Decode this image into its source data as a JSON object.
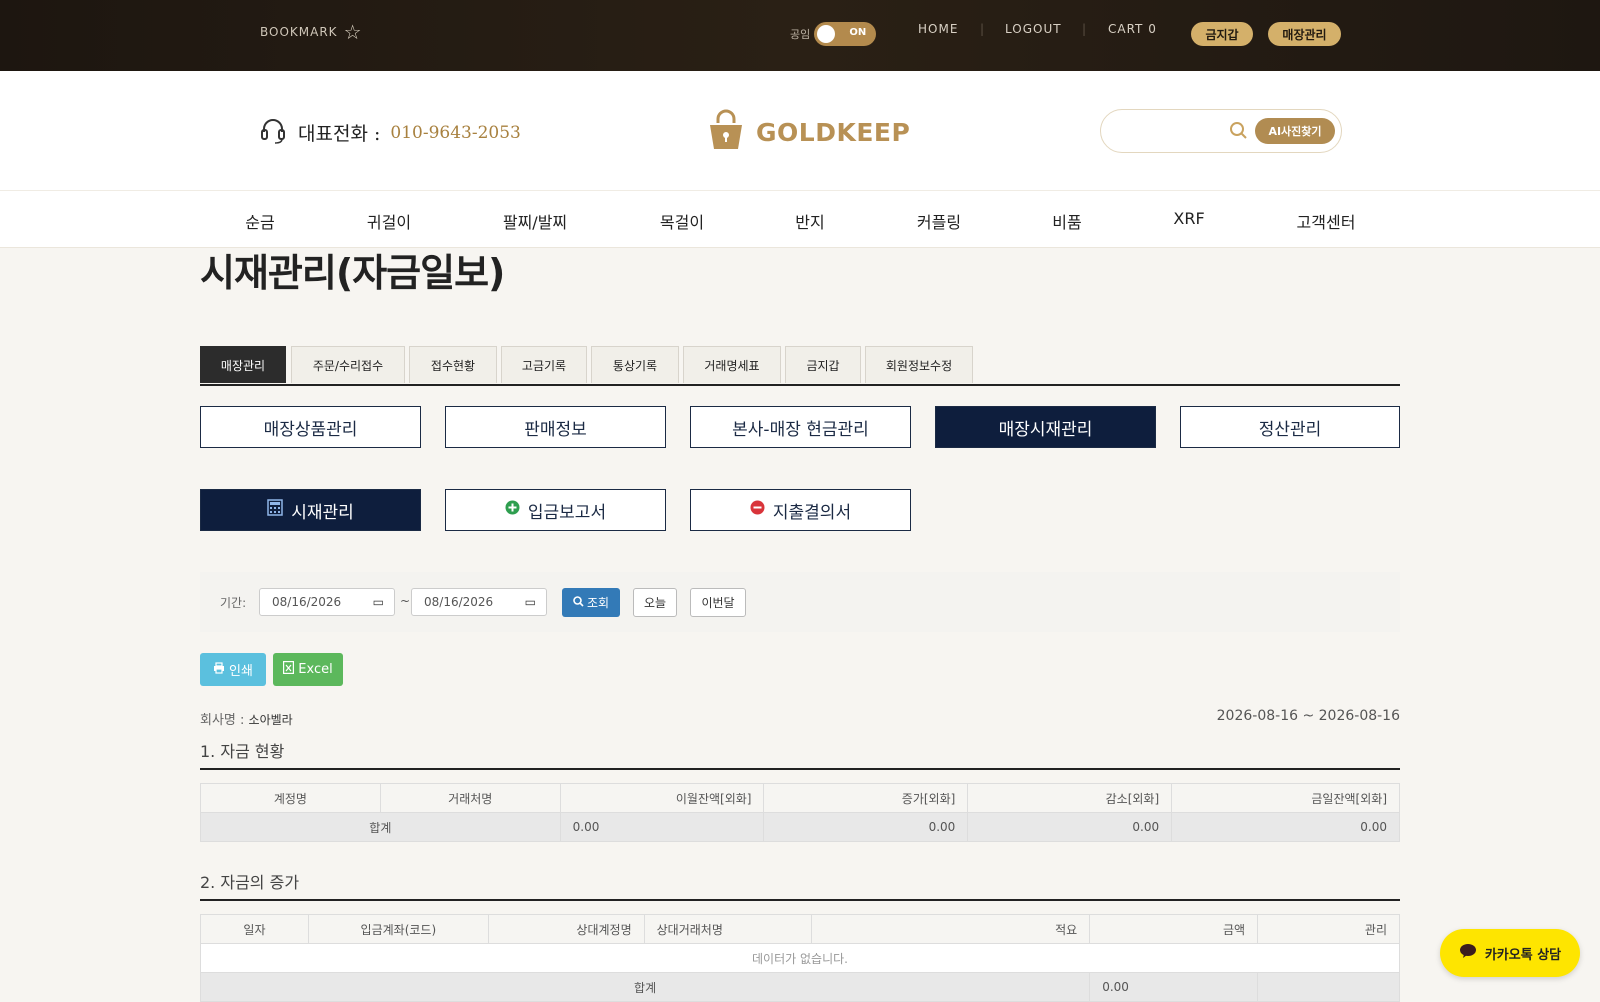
{
  "topbar": {
    "bookmark_label": "BOOKMARK",
    "toggle_label": "공임",
    "toggle_state": "ON",
    "nav": [
      "HOME",
      "LOGOUT",
      "CART 0"
    ],
    "pill_gold_wallet": "금지갑",
    "pill_store_manage": "매장관리"
  },
  "header": {
    "phone_label": "대표전화 :",
    "phone_number": "010-9643-2053",
    "logo_text": "GOLDKEEP",
    "search_placeholder": "",
    "ai_button": "AI사진찾기"
  },
  "categories": [
    "순금",
    "귀걸이",
    "팔찌/발찌",
    "목걸이",
    "반지",
    "커플링",
    "비품",
    "XRF",
    "고객센터"
  ],
  "page_title": "시재관리(자금일보)",
  "tabs": [
    "매장관리",
    "주문/수리접수",
    "접수현황",
    "고금기록",
    "통상기록",
    "거래명세표",
    "금지갑",
    "회원정보수정"
  ],
  "active_tab": "매장관리",
  "menu_buttons": [
    "매장상품관리",
    "판매정보",
    "본사-매장 현금관리",
    "매장시재관리",
    "정산관리"
  ],
  "sub_buttons": [
    "시재관리",
    "입금보고서",
    "지출결의서"
  ],
  "filter": {
    "label": "기간:",
    "start_date": "08/16/2026",
    "end_date": "08/16/2026",
    "tilde": "~",
    "search_label": "조회",
    "today_label": "오늘",
    "month_label": "이번달"
  },
  "actions": {
    "print_label": "인쇄",
    "excel_label": "Excel"
  },
  "report": {
    "company_label": "회사명 :",
    "company_name": "소아벨라",
    "date_range": "2026-08-16 ~ 2026-08-16"
  },
  "section1": {
    "title": "1. 자금 현황",
    "headers": [
      "계정명",
      "거래처명",
      "이월잔액[외화]",
      "증가[외화]",
      "감소[외화]",
      "금일잔액[외화]"
    ],
    "total_label": "합계",
    "totals": [
      "0.00",
      "0.00",
      "0.00",
      "0.00"
    ]
  },
  "section2": {
    "title": "2. 자금의 증가",
    "headers": [
      "일자",
      "입금계좌(코드)",
      "상대계정명",
      "상대거래처명",
      "적요",
      "금액",
      "관리"
    ],
    "empty_message": "데이터가 없습니다.",
    "total_label": "합계",
    "total_amount": "0.00"
  },
  "kakao_label": "카카오톡 상담",
  "colors": {
    "accent_gold": "#b89155",
    "navy": "#0e1e3d",
    "print_blue": "#5bc0de",
    "excel_green": "#5cb85c",
    "search_blue": "#337ab7",
    "kakao_yellow": "#fee500"
  }
}
